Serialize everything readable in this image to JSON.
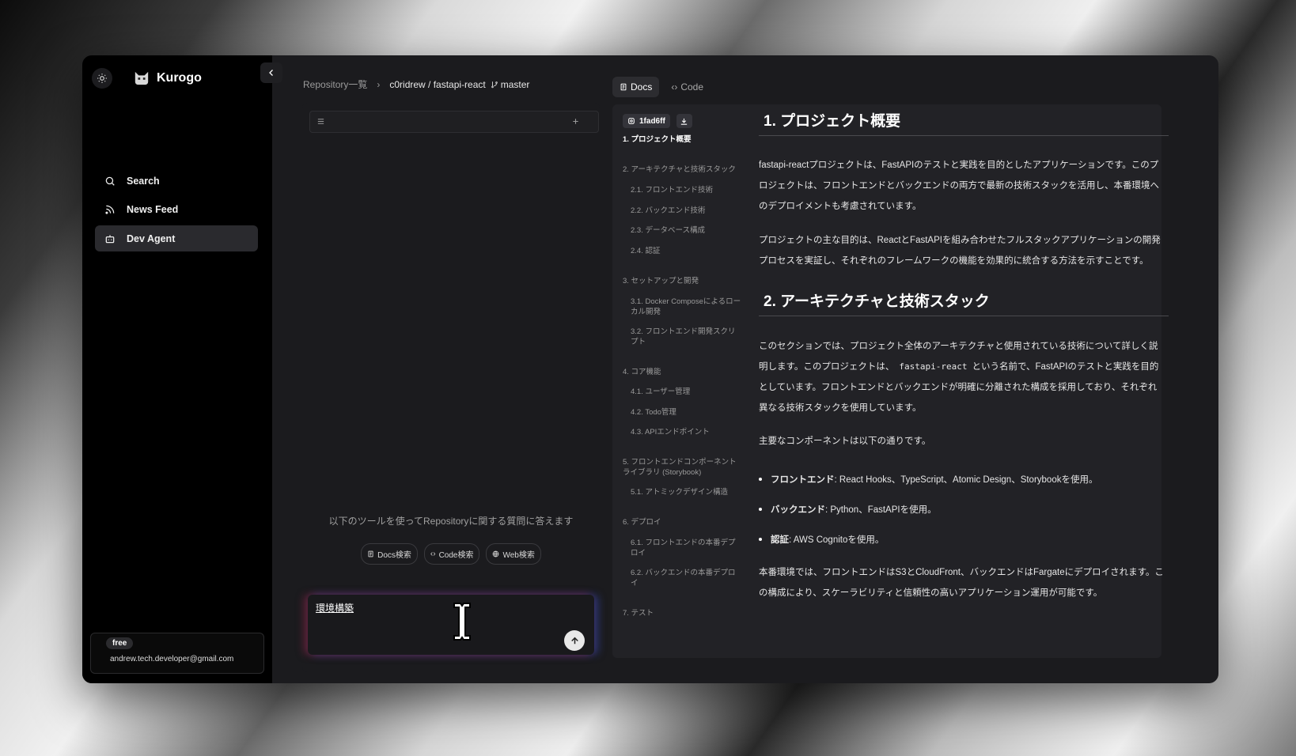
{
  "app": {
    "name": "Kurogo"
  },
  "sidebar": {
    "items": [
      {
        "label": "Search",
        "icon": "search-icon"
      },
      {
        "label": "News Feed",
        "icon": "rss-icon"
      },
      {
        "label": "Dev Agent",
        "icon": "bot-icon",
        "active": true
      }
    ],
    "user": {
      "plan": "free",
      "email": "andrew.tech.developer@gmail.com"
    }
  },
  "breadcrumb": {
    "root": "Repository一覧",
    "repo": "c0ridrew / fastapi-react",
    "branch": "master"
  },
  "chat": {
    "hint": "以下のツールを使ってRepositoryに関する質問に答えます",
    "tools": [
      "Docs検索",
      "Code検索",
      "Web検索"
    ],
    "input_value": "環境構築"
  },
  "docs": {
    "tabs": [
      "Docs",
      "Code"
    ],
    "commit": "1fad6ff",
    "toc": [
      {
        "label": "1. プロジェクト概要"
      },
      {
        "label": "2. アーキテクチャと技術スタック"
      },
      {
        "label": "2.1. フロントエンド技術"
      },
      {
        "label": "2.2. バックエンド技術"
      },
      {
        "label": "2.3. データベース構成"
      },
      {
        "label": "2.4. 認証"
      },
      {
        "label": "3. セットアップと開発"
      },
      {
        "label": "3.1. Docker Composeによるローカル開発"
      },
      {
        "label": "3.2. フロントエンド開発スクリプト"
      },
      {
        "label": "4. コア機能"
      },
      {
        "label": "4.1. ユーザー管理"
      },
      {
        "label": "4.2. Todo管理"
      },
      {
        "label": "4.3. APIエンドポイント"
      },
      {
        "label": "5. フロントエンドコンポーネントライブラリ (Storybook)"
      },
      {
        "label": "5.1. アトミックデザイン構造"
      },
      {
        "label": "6. デプロイ"
      },
      {
        "label": "6.1. フロントエンドの本番デプロイ"
      },
      {
        "label": "6.2. バックエンドの本番デプロイ"
      },
      {
        "label": "7. テスト"
      }
    ],
    "h1_overview": "1. プロジェクト概要",
    "p1": "fastapi-reactプロジェクトは、FastAPIのテストと実践を目的としたアプリケーションです。このプロジェクトは、フロントエンドとバックエンドの両方で最新の技術スタックを活用し、本番環境へのデプロイメントも考慮されています。",
    "p2": "プロジェクトの主な目的は、ReactとFastAPIを組み合わせたフルスタックアプリケーションの開発プロセスを実証し、それぞれのフレームワークの機能を効果的に統合する方法を示すことです。",
    "h1_arch": "2. アーキテクチャと技術スタック",
    "p3_a": "このセクションでは、プロジェクト全体のアーキテクチャと使用されている技術について詳しく説明します。このプロジェクトは、",
    "p3_code": "fastapi-react",
    "p3_b": "という名前で、FastAPIのテストと実践を目的としています。フロントエンドとバックエンドが明確に分離された構成を採用しており、それぞれ異なる技術スタックを使用しています。",
    "p4": "主要なコンポーネントは以下の通りです。",
    "bullets": [
      {
        "term": "フロントエンド",
        "desc": ": React Hooks、TypeScript、Atomic Design、Storybookを使用。"
      },
      {
        "term": "バックエンド",
        "desc": ": Python、FastAPIを使用。"
      },
      {
        "term": "認証",
        "desc": ": AWS Cognitoを使用。"
      }
    ],
    "p5": "本番環境では、フロントエンドはS3とCloudFront、バックエンドはFargateにデプロイされます。この構成により、スケーラビリティと信頼性の高いアプリケーション運用が可能です。"
  }
}
